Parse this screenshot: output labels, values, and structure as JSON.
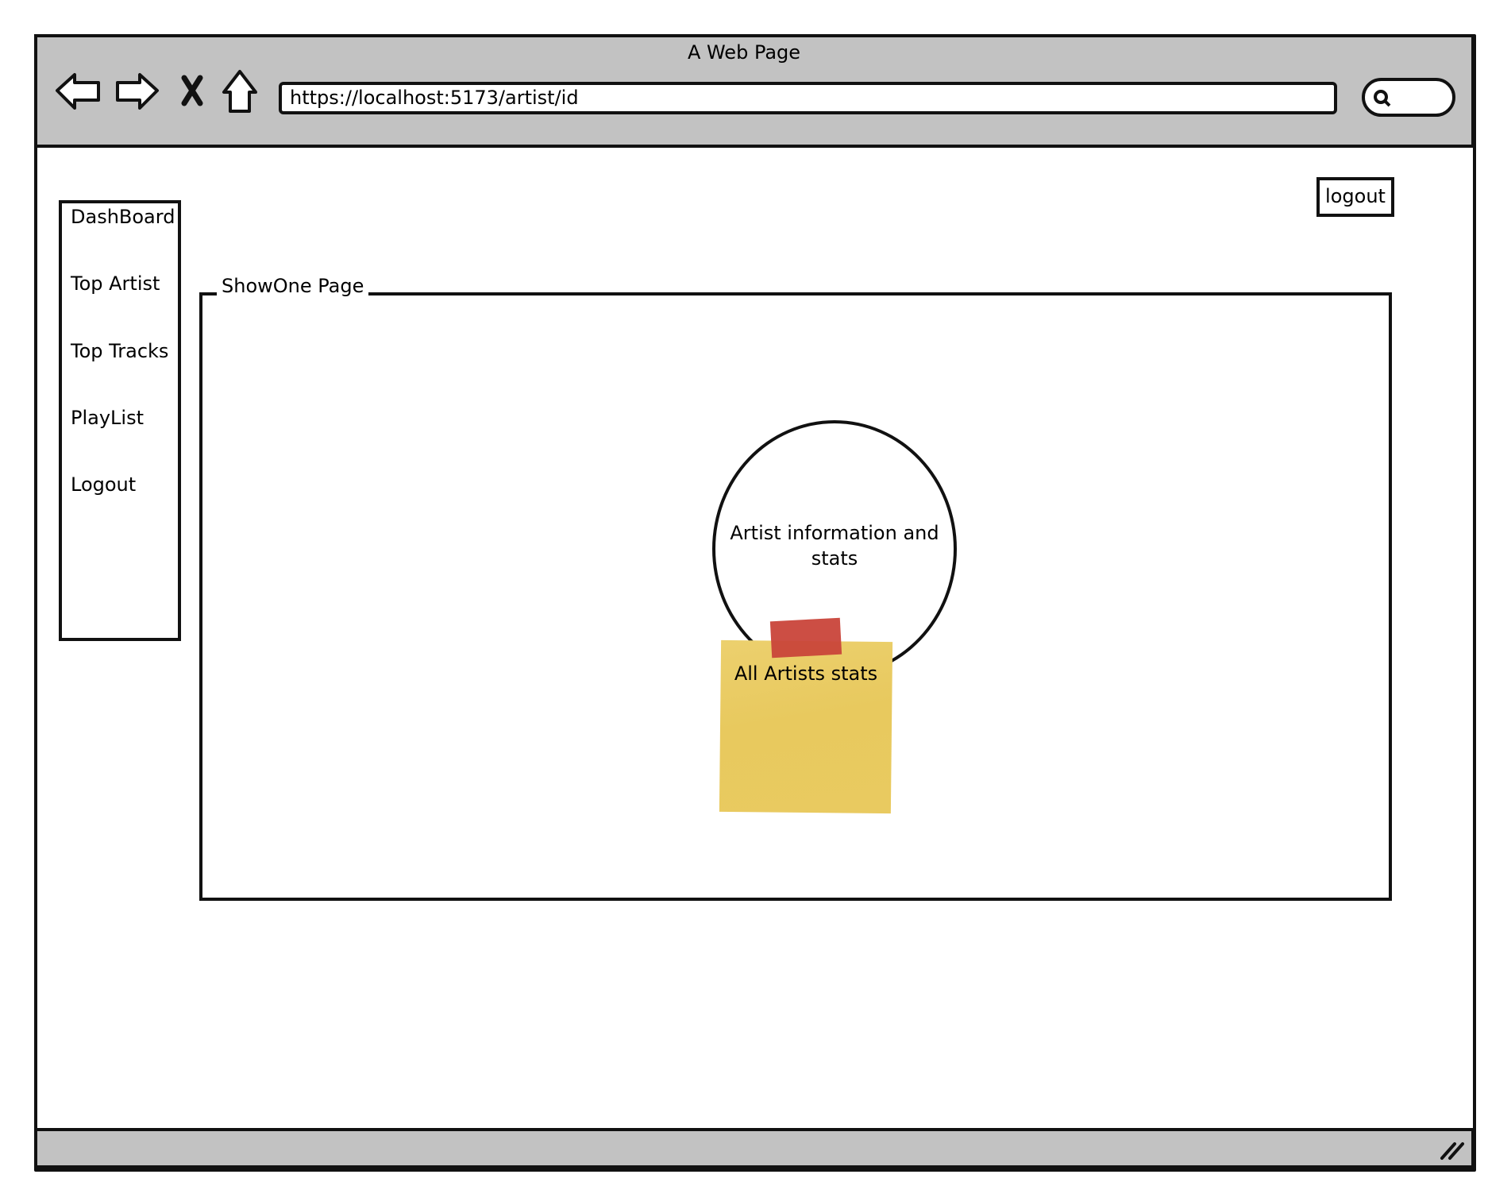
{
  "browser": {
    "title": "A Web Page",
    "url": "https://localhost:5173/artist/id",
    "icons": [
      "back-arrow-icon",
      "forward-arrow-icon",
      "close-x-icon",
      "home-icon",
      "search-icon",
      "resize-grip-icon"
    ]
  },
  "header": {
    "logout_label": "logout"
  },
  "sidebar": {
    "items": [
      {
        "label": "DashBoard"
      },
      {
        "label": "Top Artist"
      },
      {
        "label": "Top Tracks"
      },
      {
        "label": "PlayList"
      },
      {
        "label": "Logout"
      }
    ]
  },
  "main": {
    "group_title": "ShowOne Page",
    "circle_text": "Artist information and stats",
    "sticky_note": "All Artists stats",
    "colors": {
      "sticky": "#e9ca60",
      "tape": "#c9453a",
      "chrome": "#c2c2c2"
    }
  }
}
